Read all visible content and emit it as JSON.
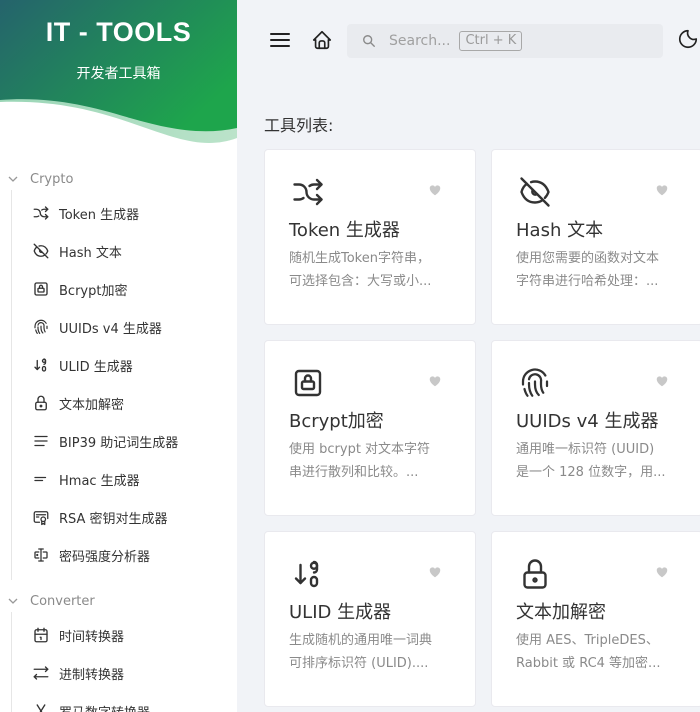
{
  "brand": {
    "title": "IT - TOOLS",
    "subtitle": "开发者工具箱"
  },
  "sidebar": {
    "groups": [
      {
        "label": "Crypto",
        "items": [
          {
            "label": "Token 生成器",
            "icon": "shuffle-icon"
          },
          {
            "label": "Hash 文本",
            "icon": "eye-off-icon"
          },
          {
            "label": "Bcrypt加密",
            "icon": "lock-square-icon"
          },
          {
            "label": "UUIDs v4 生成器",
            "icon": "fingerprint-icon"
          },
          {
            "label": "ULID 生成器",
            "icon": "sort-numeric-icon"
          },
          {
            "label": "文本加解密",
            "icon": "lock-icon"
          },
          {
            "label": "BIP39 助记词生成器",
            "icon": "align-justified-icon"
          },
          {
            "label": "Hmac 生成器",
            "icon": "short-text-icon"
          },
          {
            "label": "RSA 密钥对生成器",
            "icon": "certificate-icon"
          },
          {
            "label": "密码强度分析器",
            "icon": "password-icon"
          }
        ]
      },
      {
        "label": "Converter",
        "items": [
          {
            "label": "时间转换器",
            "icon": "calendar-icon"
          },
          {
            "label": "进制转换器",
            "icon": "arrows-left-right-icon"
          },
          {
            "label": "罗马数字转换器",
            "icon": "letter-x-icon"
          }
        ]
      }
    ]
  },
  "header": {
    "search_placeholder": "Search...",
    "search_shortcut": "Ctrl + K"
  },
  "main": {
    "section_title": "工具列表:",
    "cards": [
      {
        "title": "Token 生成器",
        "desc": [
          "随机生成Token字符串，",
          "可选择包含：大写或小..."
        ],
        "icon": "shuffle-icon"
      },
      {
        "title": "Hash 文本",
        "desc": [
          "使用您需要的函数对文本",
          "字符串进行哈希处理：..."
        ],
        "icon": "eye-off-icon"
      },
      {
        "title": "Bcrypt加密",
        "desc": [
          "使用 bcrypt 对文本字符",
          "串进行散列和比较。..."
        ],
        "icon": "lock-square-icon"
      },
      {
        "title": "UUIDs v4 生成器",
        "desc": [
          "通用唯一标识符 (UUID)",
          "是一个 128 位数字，用..."
        ],
        "icon": "fingerprint-icon"
      },
      {
        "title": "ULID 生成器",
        "desc": [
          "生成随机的通用唯一词典",
          "可排序标识符 (ULID)...."
        ],
        "icon": "sort-numeric-icon"
      },
      {
        "title": "文本加解密",
        "desc": [
          "使用 AES、TripleDES、",
          "Rabbit 或 RC4 等加密..."
        ],
        "icon": "lock-icon"
      }
    ]
  },
  "colors": {
    "brand_start": "#25636c",
    "brand_end": "#1ea54c",
    "background": "#f1f3f7"
  }
}
